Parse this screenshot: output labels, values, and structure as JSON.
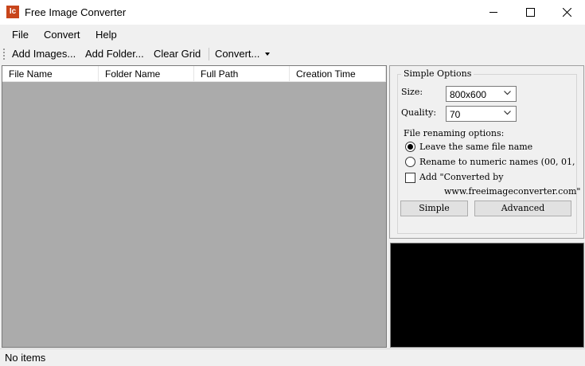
{
  "window": {
    "title": "Free Image Converter",
    "icon_text": "Ic",
    "controls": [
      "minimize-icon",
      "maximize-icon",
      "close-icon"
    ]
  },
  "menu": {
    "items": [
      "File",
      "Convert",
      "Help"
    ]
  },
  "toolbar": {
    "add_images": "Add Images...",
    "add_folder": "Add Folder...",
    "clear_grid": "Clear Grid",
    "convert": "Convert...",
    "convert_dropdown_icon": "chevron-down-icon"
  },
  "grid": {
    "columns": [
      "File Name",
      "Folder Name",
      "Full Path",
      "Creation Time"
    ],
    "rows": []
  },
  "options": {
    "group_title": "Simple Options",
    "size_label": "Size:",
    "size_value": "800x600",
    "quality_label": "Quality:",
    "quality_value": "70",
    "renaming_label": "File renaming options:",
    "radio_leave": "Leave the same file name",
    "radio_leave_checked": true,
    "radio_rename": "Rename to numeric names (00, 01, ..",
    "radio_rename_checked": false,
    "checkbox_add_line1": "Add \"Converted by",
    "checkbox_add_line2": "www.freeimageconverter.com\"",
    "checkbox_add_checked": false,
    "simple_button": "Simple",
    "advanced_button": "Advanced"
  },
  "status": {
    "text": "No items"
  },
  "colors": {
    "app_icon": "#c8451b",
    "grid_background": "#ababab",
    "preview_background": "#000000"
  }
}
